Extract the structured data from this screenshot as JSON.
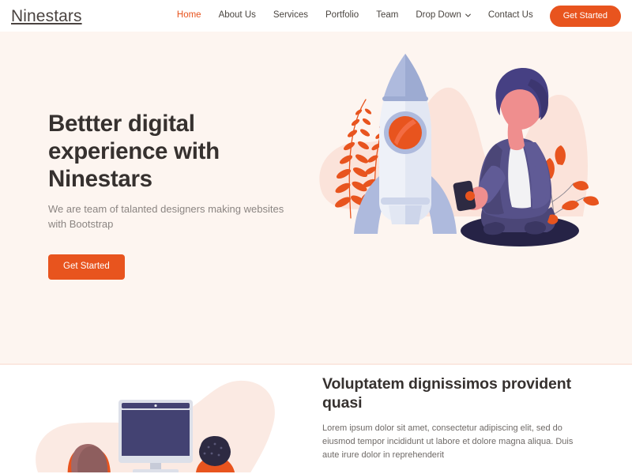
{
  "header": {
    "brand": "Ninestars",
    "nav_items": [
      {
        "label": "Home",
        "active": true,
        "dropdown": false
      },
      {
        "label": "About Us",
        "active": false,
        "dropdown": false
      },
      {
        "label": "Services",
        "active": false,
        "dropdown": false
      },
      {
        "label": "Portfolio",
        "active": false,
        "dropdown": false
      },
      {
        "label": "Team",
        "active": false,
        "dropdown": false
      },
      {
        "label": "Drop Down",
        "active": false,
        "dropdown": true
      },
      {
        "label": "Contact Us",
        "active": false,
        "dropdown": false
      }
    ],
    "cta_label": "Get Started",
    "dropdown_icon": "chevron-down-icon"
  },
  "hero": {
    "title": "Bettter digital experience with Ninestars",
    "subtitle": "We are team of talanted designers making websites with Bootstrap",
    "cta_label": "Get Started",
    "illustration": "rocket-and-seated-person-with-tablet-illustration"
  },
  "section_two": {
    "title": "Voluptatem dignissimos provident quasi",
    "paragraph": "Lorem ipsum dolor sit amet, consectetur adipiscing elit, sed do eiusmod tempor incididunt ut labore et dolore magna aliqua. Duis aute irure dolor in reprehenderit",
    "illustration": "two-people-at-desktop-monitor-illustration"
  },
  "colors": {
    "accent_orange": "#e8541e",
    "hero_background": "#fdf5f0",
    "hero_divider": "#fbe8e0",
    "blob_pink": "#fbe3da",
    "heading_dark": "#36312f",
    "body_gray": "#8b8582",
    "rocket_blue": "#aebadd",
    "figure_purple": "#565189",
    "skin_pink": "#ef8e8e",
    "monitor_navy": "#434272"
  }
}
